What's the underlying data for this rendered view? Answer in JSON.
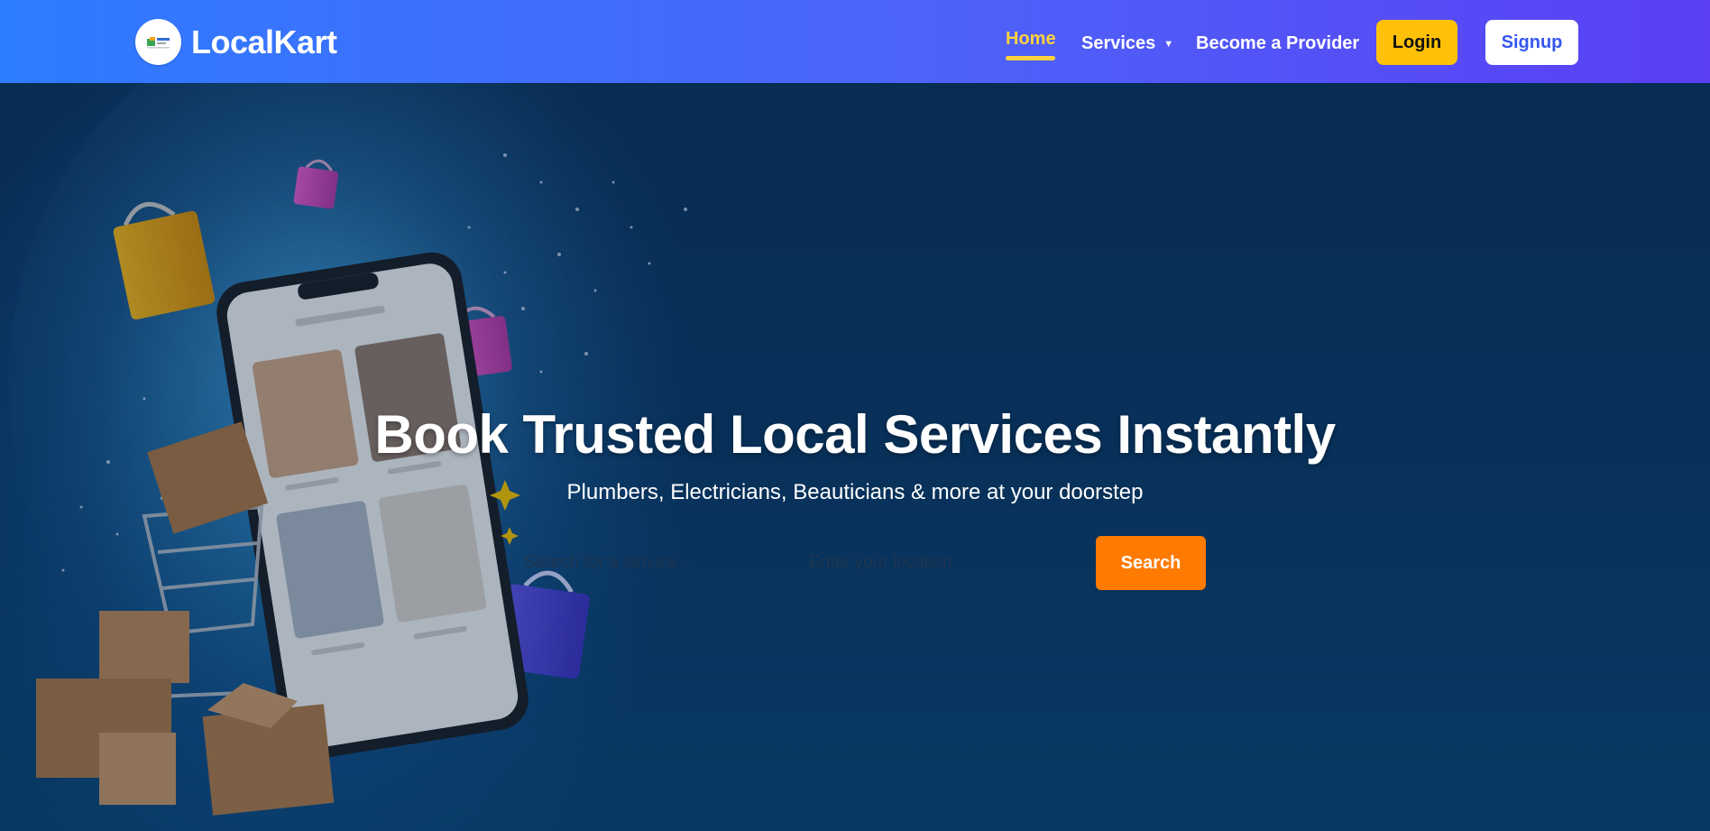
{
  "brand": {
    "name": "LocalKart",
    "logo_icon": "shop-logo-icon"
  },
  "nav": {
    "home": "Home",
    "services": "Services",
    "services_caret": "▼",
    "provider": "Become a Provider",
    "login": "Login",
    "signup": "Signup"
  },
  "hero": {
    "title": "Book Trusted Local Services Instantly",
    "subtitle": "Plumbers, Electricians, Beauticians & more at your doorstep",
    "search_placeholder": "Search for a service...",
    "location_placeholder": "Enter your location",
    "search_button": "Search"
  },
  "colors": {
    "header_start": "#2e7cff",
    "header_end": "#5a3ff5",
    "accent_yellow": "#ffc107",
    "active_link": "#ffd23f",
    "search_orange": "#ff7a00"
  }
}
